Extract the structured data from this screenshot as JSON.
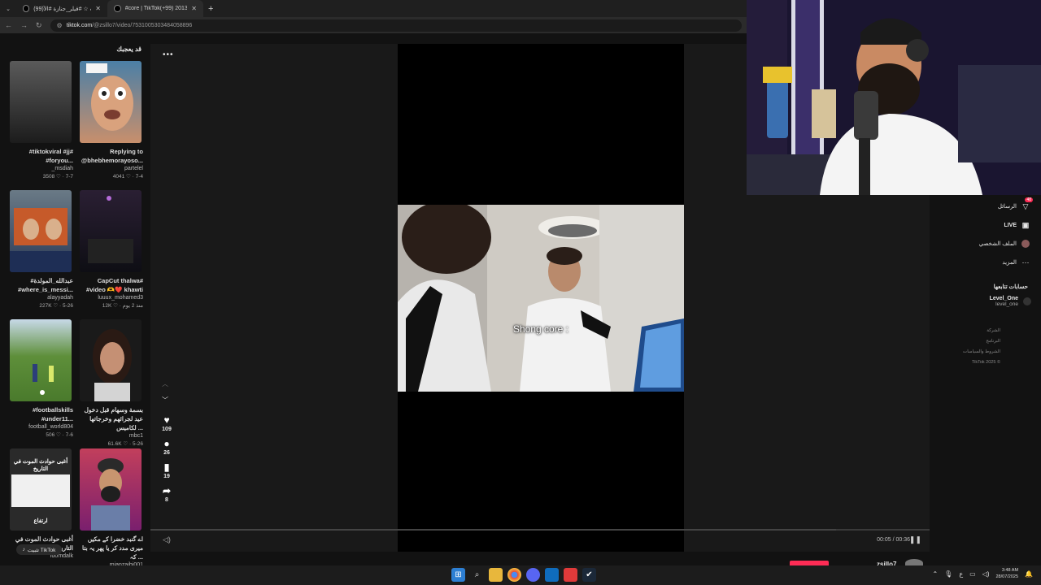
{
  "browser": {
    "tabs": [
      {
        "title": "(99)هو طلب ☆ #فيلر_جنازة #الأ ..."
      },
      {
        "title": "#core | TikTok(+99) 2013_"
      }
    ],
    "url_host": "tiktok.com",
    "url_path": "/@zsillo7/video/7531005303484058896"
  },
  "sidebar": {
    "title": "قد يعجبك",
    "cards": [
      {
        "caption": "Replying to @bhebhemorayoso...",
        "user": "partelel",
        "meta": "4041 ♡ · 7-4"
      },
      {
        "caption": "#tiktokviral #jj# #foryou...",
        "user": "_msdiah",
        "meta": "3508 ♡ · 7-7"
      },
      {
        "caption": "CapCut thalwa# #video 🫶❤️ khawti",
        "user": "luuux_mohamed3",
        "meta": "12K ♡ · منذ 2 يوم"
      },
      {
        "caption": "#عبدالله_المولدة #where_is_messi...",
        "user": "alayyadah",
        "meta": "227K ♡ · 5-26"
      },
      {
        "caption": "بسمة وسهام قبل دخول عيد لجرائهم وخرجاتها لكاميس ...",
        "user": "mbc1",
        "meta": "61.6K ♡ · 5-26"
      },
      {
        "caption": "#footballskills #under11...",
        "user": "football_world804",
        "meta": "506 ♡ · 7-6"
      },
      {
        "caption": "اے گنبد خضرا کے مکیں میری مدد کر یا پھر یہ بتا کہ ...",
        "user": "mianzaibi001",
        "meta": ""
      },
      {
        "caption": "أغبى حوادث الموت في التاريخ",
        "user": "Idomdalk",
        "meta": ""
      }
    ],
    "thumb4_line1": "أغبى حوادث الموت في",
    "thumb4_line2": "التاريخ",
    "thumb4_bottom": "ارتفاع",
    "install_label": "تثبيت TikTok"
  },
  "video": {
    "subtitle": "Shong core :",
    "likes": "109",
    "comments": "26",
    "saves": "19",
    "shares": "8",
    "time": "00:05 / 00:36",
    "author": "zsillo7",
    "progress": 0.88
  },
  "right_nav": {
    "items": [
      {
        "label": "الرسائل",
        "badge": "48"
      },
      {
        "label": "LIVE"
      },
      {
        "label": "الملف الشخصي"
      },
      {
        "label": "المزيد"
      }
    ],
    "following_title": "حسابات تتابعها",
    "following_name": "Level_One",
    "following_handle": "level_one",
    "footer": [
      "الشركة",
      "البرنامج",
      "الشروط والسياسات",
      "TikTok 2025 ©"
    ]
  },
  "taskbar": {
    "time": "3:48 AM",
    "date": "28/07/2025",
    "lang": "ع"
  },
  "colors": {
    "accent": "#fe2c55",
    "bg": "#121212"
  }
}
